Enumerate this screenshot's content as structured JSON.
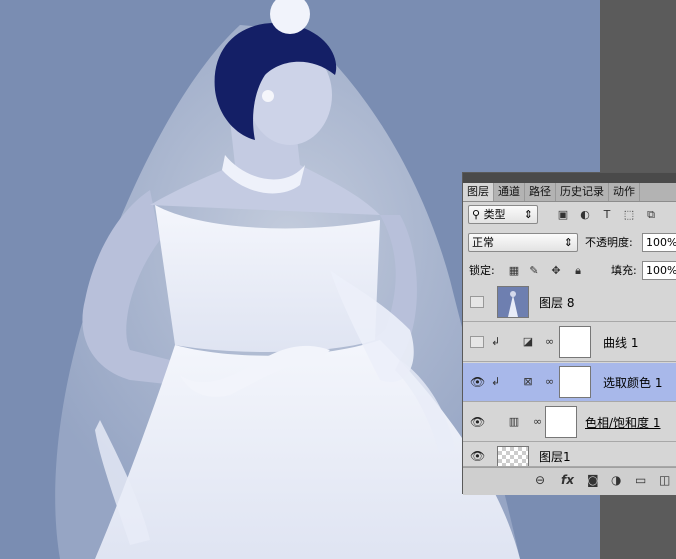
{
  "panel": {
    "tabs": [
      "图层",
      "通道",
      "路径",
      "历史记录",
      "动作"
    ],
    "filter": {
      "icon": "search-icon",
      "label": "类型"
    },
    "blend_mode": "正常",
    "opacity_label": "不透明度:",
    "opacity_value": "100%",
    "lock_label": "锁定:",
    "fill_label": "填充:",
    "fill_value": "100%"
  },
  "layers": [
    {
      "name": "图层 8",
      "visible": false,
      "selected": false
    },
    {
      "name": "曲线 1",
      "visible": false,
      "selected": false
    },
    {
      "name": "选取颜色 1",
      "visible": true,
      "selected": true
    },
    {
      "name": "色相/饱和度 1",
      "visible": true,
      "selected": false
    },
    {
      "name": "图层1",
      "visible": true,
      "selected": false
    }
  ],
  "footer_labels": {
    "fx": "fx"
  },
  "colors": {
    "canvas_bg": "#7a8db2",
    "selected_layer": "#a8b8ea",
    "panel_bg": "#d6d6d6"
  }
}
